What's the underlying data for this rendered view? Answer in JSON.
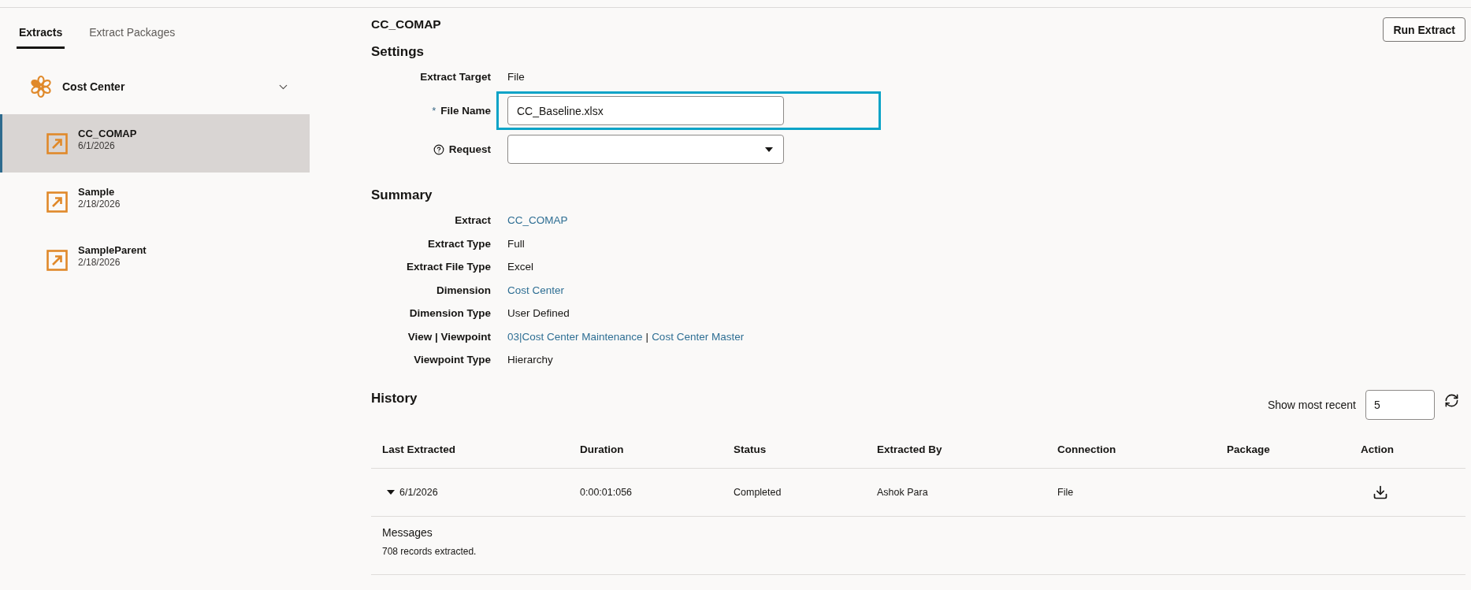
{
  "sidebar": {
    "tabs": [
      {
        "label": "Extracts",
        "selected": true
      },
      {
        "label": "Extract Packages",
        "selected": false
      }
    ],
    "group": {
      "label": "Cost Center",
      "expanded": true,
      "items": [
        {
          "name": "CC_COMAP",
          "date": "6/1/2026",
          "selected": true
        },
        {
          "name": "Sample",
          "date": "2/18/2026",
          "selected": false
        },
        {
          "name": "SampleParent",
          "date": "2/18/2026",
          "selected": false
        }
      ]
    }
  },
  "header": {
    "title": "CC_COMAP",
    "run_button": "Run Extract"
  },
  "settings": {
    "heading": "Settings",
    "fields": [
      {
        "kind": "static",
        "label": "Extract Target",
        "value": "File"
      },
      {
        "kind": "input",
        "label": "File Name",
        "required_mark": "*",
        "highlighted": true,
        "value": "CC_Baseline.xlsx"
      },
      {
        "kind": "select",
        "label": "Request",
        "help": true
      }
    ]
  },
  "summary": {
    "heading": "Summary",
    "rows": [
      {
        "label": "Extract",
        "parts": [
          {
            "text": "CC_COMAP",
            "link": true
          }
        ]
      },
      {
        "label": "Extract Type",
        "parts": [
          {
            "text": "Full",
            "link": false
          }
        ]
      },
      {
        "label": "Extract File Type",
        "parts": [
          {
            "text": "Excel",
            "link": false
          }
        ]
      },
      {
        "label": "Dimension",
        "parts": [
          {
            "text": "Cost Center",
            "link": true
          }
        ]
      },
      {
        "label": "Dimension Type",
        "parts": [
          {
            "text": "User Defined",
            "link": false
          }
        ]
      },
      {
        "label": "View | Viewpoint",
        "parts": [
          {
            "text": "03|Cost Center Maintenance",
            "link": true
          },
          {
            "text": "|",
            "link": false
          },
          {
            "text": "Cost Center Master",
            "link": true
          }
        ]
      },
      {
        "label": "Viewpoint Type",
        "parts": [
          {
            "text": "Hierarchy",
            "link": false
          }
        ]
      }
    ]
  },
  "history": {
    "heading": "History",
    "recent": {
      "label": "Show most recent",
      "value": "5"
    },
    "columns": [
      "Last Extracted",
      "Duration",
      "Status",
      "Extracted By",
      "Connection",
      "Package",
      "Action"
    ],
    "rows": [
      {
        "expanded": true,
        "last_extracted": "6/1/2026",
        "duration": "0:00:01:056",
        "status": "Completed",
        "extracted_by": "Ashok Para",
        "connection": "File",
        "messages": {
          "label": "Messages",
          "text": "708 records extracted."
        }
      }
    ]
  }
}
